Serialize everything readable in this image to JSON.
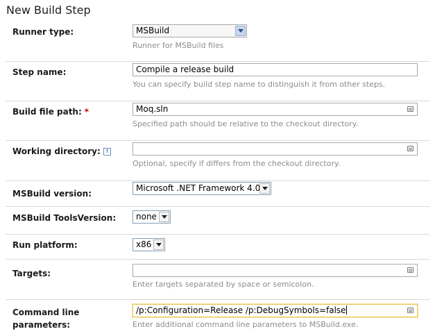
{
  "title": "New Build Step",
  "runner": {
    "label": "Runner type:",
    "value": "MSBuild",
    "hint": "Runner for MSBuild files"
  },
  "step_name": {
    "label": "Step name:",
    "value": "Compile a release build",
    "hint": "You can specify build step name to distinguish it from other steps."
  },
  "build_file": {
    "label": "Build file path:",
    "required": "*",
    "value": "Moq.sln",
    "hint": "Specified path should be relative to the checkout directory."
  },
  "working_dir": {
    "label": "Working directory:",
    "help": "?",
    "value": "",
    "hint": "Optional, specify if differs from the checkout directory."
  },
  "msbuild_version": {
    "label": "MSBuild version:",
    "value": "Microsoft .NET Framework 4.0"
  },
  "tools_version": {
    "label": "MSBuild ToolsVersion:",
    "value": "none"
  },
  "run_platform": {
    "label": "Run platform:",
    "value": "x86"
  },
  "targets": {
    "label": "Targets:",
    "value": "",
    "hint": "Enter targets separated by space or semicolon."
  },
  "command_line": {
    "label_line1": "Command line",
    "label_line2": "parameters:",
    "value": "/p:Configuration=Release /p:DebugSymbols=false",
    "hint": "Enter additional command line parameters to MSBuild.exe."
  }
}
